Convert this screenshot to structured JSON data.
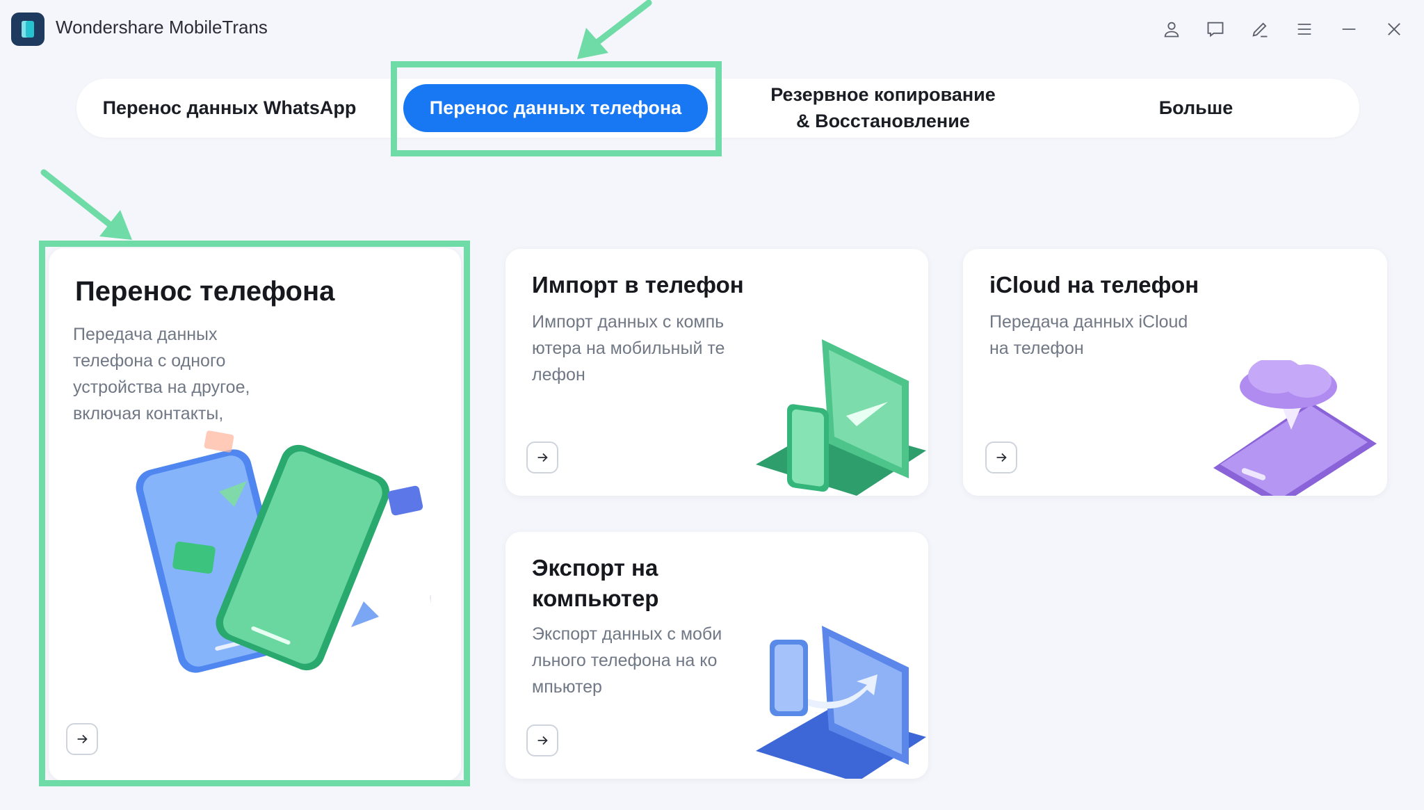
{
  "app": {
    "title": "Wondershare MobileTrans",
    "logo_icon": "mobiletrans-logo",
    "window_controls": [
      "account-icon",
      "feedback-icon",
      "edit-icon",
      "menu-icon",
      "minimize-icon",
      "close-icon"
    ]
  },
  "tabs": {
    "whatsapp": "Перенос данных WhatsApp",
    "phone": "Перенос данных телефона",
    "backup_line1": "Резервное копирование",
    "backup_line2": "& Восстановление",
    "more": "Больше",
    "active": "phone"
  },
  "cards": {
    "phone_transfer": {
      "title": "Перенос телефона",
      "desc": "Передача данных\nтелефона с одного\nустройства на другое,\nвключая контакты,"
    },
    "import": {
      "title": "Импорт в телефон",
      "desc": "Импорт данных с компь\nютера на мобильный те\nлефон"
    },
    "icloud": {
      "title": "iCloud на телефон",
      "desc": "Передача данных iCloud\nна телефон"
    },
    "export": {
      "title": "Экспорт на\nкомпьютер",
      "desc": "Экспорт данных с моби\nльного телефона на ко\nмпьютер"
    }
  },
  "colors": {
    "accent_blue": "#1877f2",
    "highlight_green": "#6fdba6",
    "background": "#f4f6fb"
  }
}
